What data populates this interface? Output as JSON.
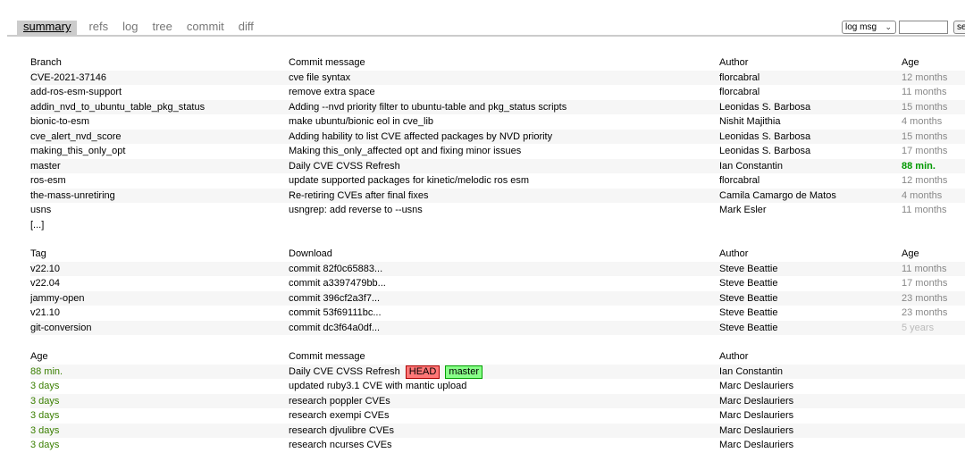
{
  "tabs": [
    "summary",
    "refs",
    "log",
    "tree",
    "commit",
    "diff"
  ],
  "search": {
    "select_value": "log msg",
    "button_label": "search"
  },
  "branches": {
    "headers": [
      "Branch",
      "Commit message",
      "Author",
      "Age"
    ],
    "rows": [
      [
        "CVE-2021-37146",
        "cve file syntax",
        "florcabral",
        "12 months"
      ],
      [
        "add-ros-esm-support",
        "remove extra space",
        "florcabral",
        "11 months"
      ],
      [
        "addin_nvd_to_ubuntu_table_pkg_status",
        "Adding --nvd priority filter to ubuntu-table and pkg_status scripts",
        "Leonidas S. Barbosa",
        "15 months"
      ],
      [
        "bionic-to-esm",
        "make ubuntu/bionic eol in cve_lib",
        "Nishit Majithia",
        "4 months"
      ],
      [
        "cve_alert_nvd_score",
        "Adding hability to list CVE affected packages by NVD priority",
        "Leonidas S. Barbosa",
        "15 months"
      ],
      [
        "making_this_only_opt",
        "Making this_only_affected opt and fixing minor issues",
        "Leonidas S. Barbosa",
        "17 months"
      ],
      [
        "master",
        "Daily CVE CVSS Refresh",
        "Ian Constantin",
        "88 min."
      ],
      [
        "ros-esm",
        "update supported packages for kinetic/melodic ros esm",
        "florcabral",
        "12 months"
      ],
      [
        "the-mass-unretiring",
        "Re-retiring CVEs after final fixes",
        "Camila Camargo de Matos",
        "4 months"
      ],
      [
        "usns",
        "usngrep: add reverse to --usns",
        "Mark Esler",
        "11 months"
      ]
    ],
    "more": "[...]"
  },
  "tags": {
    "headers": [
      "Tag",
      "Download",
      "Author",
      "Age"
    ],
    "rows": [
      [
        "v22.10",
        "commit 82f0c65883...",
        "Steve Beattie",
        "11 months"
      ],
      [
        "v22.04",
        "commit a3397479bb...",
        "Steve Beattie",
        "17 months"
      ],
      [
        "jammy-open",
        "commit 396cf2a3f7...",
        "Steve Beattie",
        "23 months"
      ],
      [
        "v21.10",
        "commit 53f69111bc...",
        "Steve Beattie",
        "23 months"
      ],
      [
        "git-conversion",
        "commit dc3f64a0df...",
        "Steve Beattie",
        "5 years"
      ]
    ]
  },
  "log": {
    "headers": [
      "Age",
      "Commit message",
      "Author"
    ],
    "rows": [
      [
        "88 min.",
        "Daily CVE CVSS Refresh",
        "Ian Constantin"
      ],
      [
        "3 days",
        "updated ruby3.1 CVE with mantic upload",
        "Marc Deslauriers"
      ],
      [
        "3 days",
        "research poppler CVEs",
        "Marc Deslauriers"
      ],
      [
        "3 days",
        "research exempi CVEs",
        "Marc Deslauriers"
      ],
      [
        "3 days",
        "research djvulibre CVEs",
        "Marc Deslauriers"
      ],
      [
        "3 days",
        "research ncurses CVEs",
        "Marc Deslauriers"
      ]
    ],
    "badges": {
      "head": "HEAD",
      "branch": "master"
    }
  },
  "colors": {
    "head_badge": "#ff7777",
    "branch_badge": "#88ff88",
    "recent_age": "#009900"
  }
}
